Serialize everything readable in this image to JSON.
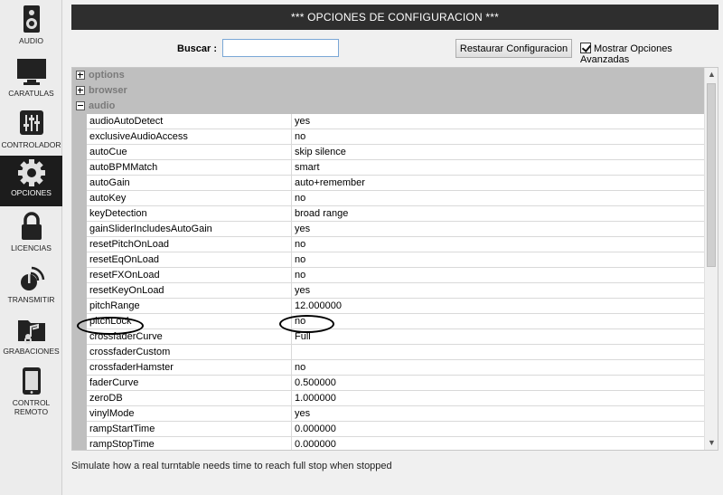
{
  "header": {
    "title": "*** OPCIONES DE CONFIGURACION ***"
  },
  "sidebar": {
    "items": [
      {
        "label": "AUDIO",
        "icon": "speaker-icon"
      },
      {
        "label": "CARATULAS",
        "icon": "monitor-icon"
      },
      {
        "label": "CONTROLADOR",
        "icon": "mixer-sliders-icon"
      },
      {
        "label": "OPCIONES",
        "icon": "gear-icon",
        "active": true
      },
      {
        "label": "LICENCIAS",
        "icon": "lock-icon"
      },
      {
        "label": "TRANSMITIR",
        "icon": "broadcast-icon"
      },
      {
        "label": "GRABACIONES",
        "icon": "music-folder-icon"
      },
      {
        "label": "CONTROL REMOTO",
        "icon": "tablet-icon"
      }
    ]
  },
  "search": {
    "label": "Buscar :",
    "value": ""
  },
  "toolbar": {
    "restore_label": "Restaurar Configuracion",
    "advanced_label": "Mostrar Opciones Avanzadas",
    "advanced_checked": true
  },
  "grid": {
    "groups_collapsed": [
      {
        "name": "options"
      },
      {
        "name": "browser"
      }
    ],
    "group_expanded": {
      "name": "audio"
    },
    "rows": [
      {
        "key": "audioAutoDetect",
        "value": "yes"
      },
      {
        "key": "exclusiveAudioAccess",
        "value": "no"
      },
      {
        "key": "autoCue",
        "value": "skip silence"
      },
      {
        "key": "autoBPMMatch",
        "value": "smart"
      },
      {
        "key": "autoGain",
        "value": "auto+remember"
      },
      {
        "key": "autoKey",
        "value": "no"
      },
      {
        "key": "keyDetection",
        "value": "broad range"
      },
      {
        "key": "gainSliderIncludesAutoGain",
        "value": "yes"
      },
      {
        "key": "resetPitchOnLoad",
        "value": "no"
      },
      {
        "key": "resetEqOnLoad",
        "value": "no"
      },
      {
        "key": "resetFXOnLoad",
        "value": "no"
      },
      {
        "key": "resetKeyOnLoad",
        "value": "yes"
      },
      {
        "key": "pitchRange",
        "value": "12.000000"
      },
      {
        "key": "pitchLock",
        "value": "no"
      },
      {
        "key": "crossfaderCurve",
        "value": "Full"
      },
      {
        "key": "crossfaderCustom",
        "value": ""
      },
      {
        "key": "crossfaderHamster",
        "value": "no"
      },
      {
        "key": "faderCurve",
        "value": "0.500000"
      },
      {
        "key": "zeroDB",
        "value": "1.000000"
      },
      {
        "key": "vinylMode",
        "value": "yes"
      },
      {
        "key": "rampStartTime",
        "value": "0.000000"
      },
      {
        "key": "rampStopTime",
        "value": "0.000000"
      }
    ]
  },
  "status": {
    "description": "Simulate how a real turntable needs time to reach full stop when stopped"
  }
}
